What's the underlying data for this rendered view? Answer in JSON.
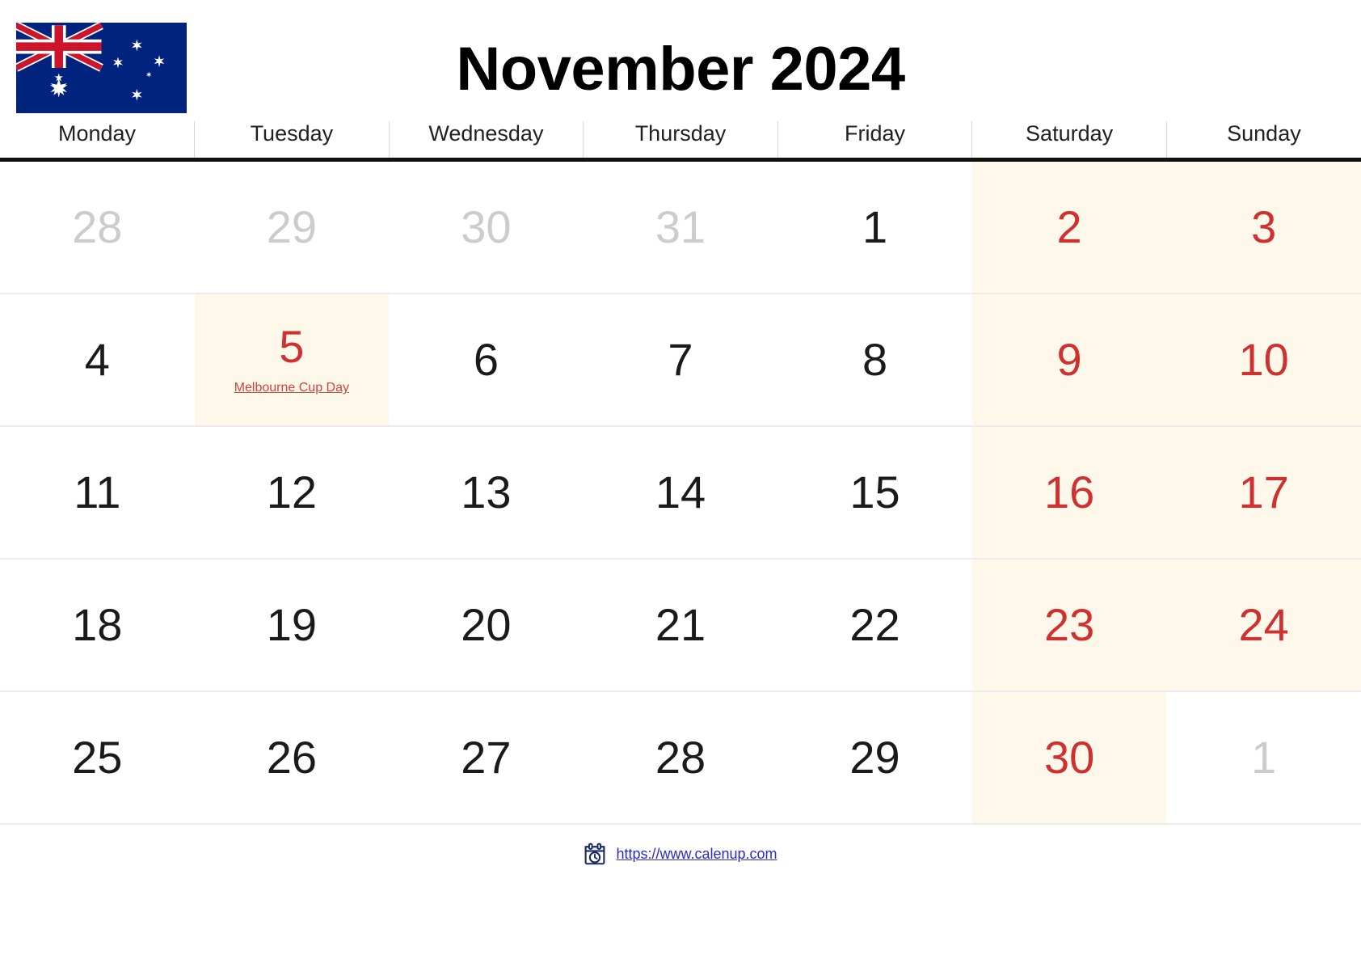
{
  "header": {
    "title": "November 2024",
    "flag_icon": "australia-flag",
    "flag_colors": {
      "navy": "#00247D",
      "red": "#CC142B",
      "white": "#FFFFFF"
    }
  },
  "colors": {
    "weekend_background": "#FDF8E9",
    "weekend_text": "#CF3030",
    "holiday_text": "#D0433F",
    "muted_text": "#CCCCCC",
    "weekday_text": "#1A1A1A",
    "header_rule": "#111111",
    "row_divider": "#ECECEC",
    "link": "#2B2BC8"
  },
  "weekdays": [
    {
      "label": "Monday",
      "weekend": false
    },
    {
      "label": "Tuesday",
      "weekend": false
    },
    {
      "label": "Wednesday",
      "weekend": false
    },
    {
      "label": "Thursday",
      "weekend": false
    },
    {
      "label": "Friday",
      "weekend": false
    },
    {
      "label": "Saturday",
      "weekend": true
    },
    {
      "label": "Sunday",
      "weekend": true
    }
  ],
  "weeks": [
    [
      {
        "day": "28",
        "muted": true,
        "weekend": false,
        "highlight": false,
        "event": null
      },
      {
        "day": "29",
        "muted": true,
        "weekend": false,
        "highlight": false,
        "event": null
      },
      {
        "day": "30",
        "muted": true,
        "weekend": false,
        "highlight": false,
        "event": null
      },
      {
        "day": "31",
        "muted": true,
        "weekend": false,
        "highlight": false,
        "event": null
      },
      {
        "day": "1",
        "muted": false,
        "weekend": false,
        "highlight": false,
        "event": null
      },
      {
        "day": "2",
        "muted": false,
        "weekend": true,
        "highlight": true,
        "event": null
      },
      {
        "day": "3",
        "muted": false,
        "weekend": true,
        "highlight": true,
        "event": null
      }
    ],
    [
      {
        "day": "4",
        "muted": false,
        "weekend": false,
        "highlight": false,
        "event": null
      },
      {
        "day": "5",
        "muted": false,
        "weekend": true,
        "highlight": true,
        "event": "Melbourne Cup Day"
      },
      {
        "day": "6",
        "muted": false,
        "weekend": false,
        "highlight": false,
        "event": null
      },
      {
        "day": "7",
        "muted": false,
        "weekend": false,
        "highlight": false,
        "event": null
      },
      {
        "day": "8",
        "muted": false,
        "weekend": false,
        "highlight": false,
        "event": null
      },
      {
        "day": "9",
        "muted": false,
        "weekend": true,
        "highlight": true,
        "event": null
      },
      {
        "day": "10",
        "muted": false,
        "weekend": true,
        "highlight": true,
        "event": null
      }
    ],
    [
      {
        "day": "11",
        "muted": false,
        "weekend": false,
        "highlight": false,
        "event": null
      },
      {
        "day": "12",
        "muted": false,
        "weekend": false,
        "highlight": false,
        "event": null
      },
      {
        "day": "13",
        "muted": false,
        "weekend": false,
        "highlight": false,
        "event": null
      },
      {
        "day": "14",
        "muted": false,
        "weekend": false,
        "highlight": false,
        "event": null
      },
      {
        "day": "15",
        "muted": false,
        "weekend": false,
        "highlight": false,
        "event": null
      },
      {
        "day": "16",
        "muted": false,
        "weekend": true,
        "highlight": true,
        "event": null
      },
      {
        "day": "17",
        "muted": false,
        "weekend": true,
        "highlight": true,
        "event": null
      }
    ],
    [
      {
        "day": "18",
        "muted": false,
        "weekend": false,
        "highlight": false,
        "event": null
      },
      {
        "day": "19",
        "muted": false,
        "weekend": false,
        "highlight": false,
        "event": null
      },
      {
        "day": "20",
        "muted": false,
        "weekend": false,
        "highlight": false,
        "event": null
      },
      {
        "day": "21",
        "muted": false,
        "weekend": false,
        "highlight": false,
        "event": null
      },
      {
        "day": "22",
        "muted": false,
        "weekend": false,
        "highlight": false,
        "event": null
      },
      {
        "day": "23",
        "muted": false,
        "weekend": true,
        "highlight": true,
        "event": null
      },
      {
        "day": "24",
        "muted": false,
        "weekend": true,
        "highlight": true,
        "event": null
      }
    ],
    [
      {
        "day": "25",
        "muted": false,
        "weekend": false,
        "highlight": false,
        "event": null
      },
      {
        "day": "26",
        "muted": false,
        "weekend": false,
        "highlight": false,
        "event": null
      },
      {
        "day": "27",
        "muted": false,
        "weekend": false,
        "highlight": false,
        "event": null
      },
      {
        "day": "28",
        "muted": false,
        "weekend": false,
        "highlight": false,
        "event": null
      },
      {
        "day": "29",
        "muted": false,
        "weekend": false,
        "highlight": false,
        "event": null
      },
      {
        "day": "30",
        "muted": false,
        "weekend": true,
        "highlight": true,
        "event": null
      },
      {
        "day": "1",
        "muted": true,
        "weekend": true,
        "highlight": false,
        "event": null
      }
    ]
  ],
  "footer": {
    "icon": "calendar-clock-icon",
    "url": "https://www.calenup.com"
  }
}
